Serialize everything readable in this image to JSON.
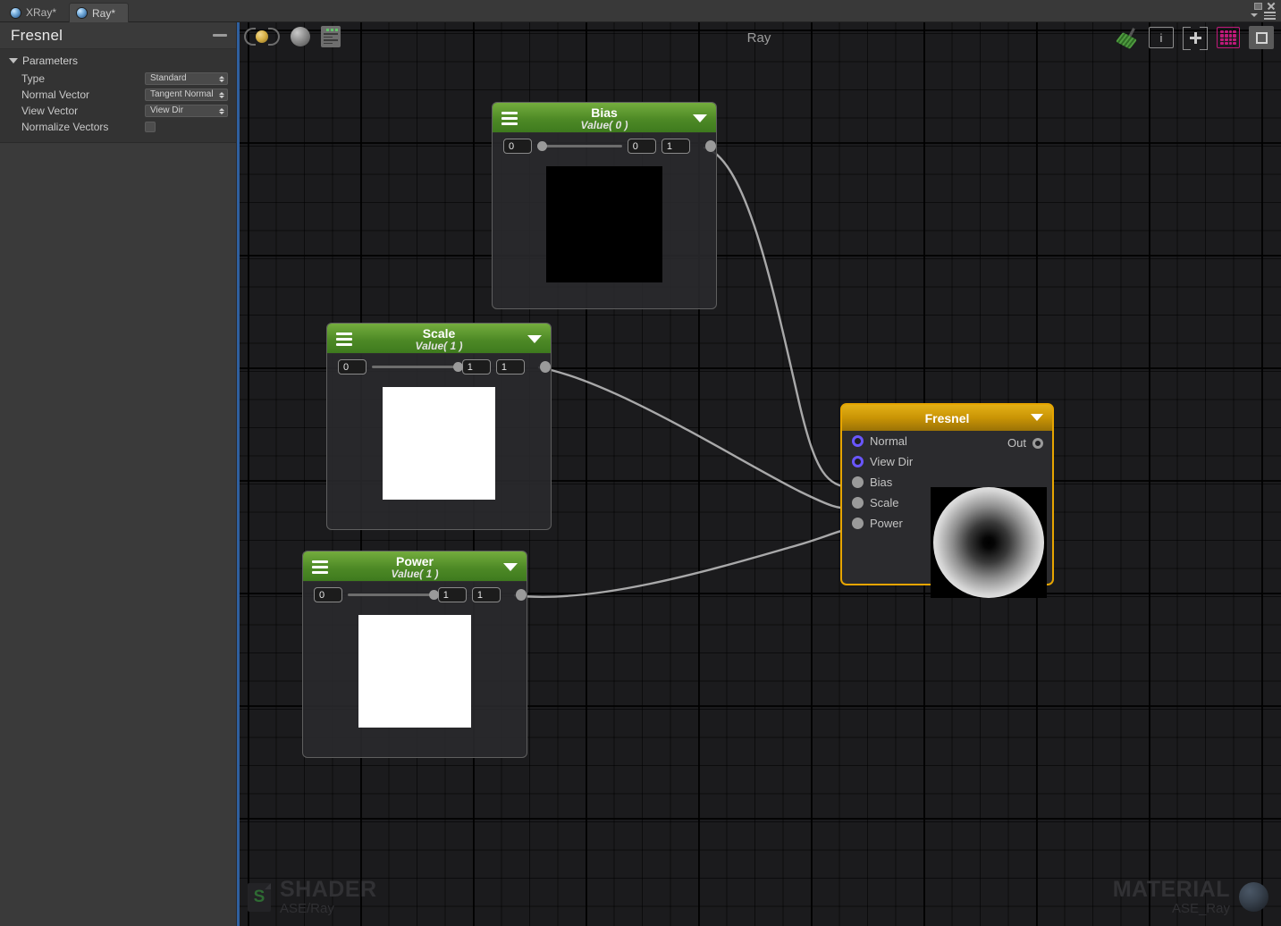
{
  "window": {
    "tabs": [
      {
        "label": "XRay*",
        "active": false
      },
      {
        "label": "Ray*",
        "active": true
      }
    ],
    "controls": {
      "restore": "restore-window",
      "close": "close-window",
      "menu": "window-menu"
    }
  },
  "inspector": {
    "title": "Fresnel",
    "minimize_label": "—",
    "foldout_label": "Parameters",
    "rows": [
      {
        "label": "Type",
        "type": "dropdown",
        "value": "Standard"
      },
      {
        "label": "Normal Vector",
        "type": "dropdown",
        "value": "Tangent Normal"
      },
      {
        "label": "View Vector",
        "type": "dropdown",
        "value": "View Dir"
      },
      {
        "label": "Normalize Vectors",
        "type": "checkbox",
        "value": ""
      }
    ]
  },
  "toolbar": {
    "title": "Ray",
    "left_icons": [
      "refresh-material-icon",
      "sphere-preview-icon",
      "shader-code-icon"
    ],
    "right_icons": [
      "cleanup-broom-icon",
      "info-icon",
      "add-node-icon",
      "grid-toggle-icon",
      "focus-icon"
    ],
    "info_glyph": "i",
    "accent_grid": "#c0197a",
    "accent_broom": "#4f9b3f"
  },
  "nodes": [
    {
      "id": "bias",
      "title": "Bias",
      "subtitle": "Value( 0 )",
      "min_field": "0",
      "max_field": "0",
      "value_field": "1",
      "slider_percent": 0,
      "preview_color": "#000000",
      "header_color": "#4e8a26"
    },
    {
      "id": "scale",
      "title": "Scale",
      "subtitle": "Value( 1 )",
      "min_field": "0",
      "max_field": "1",
      "value_field": "1",
      "slider_percent": 100,
      "preview_color": "#ffffff",
      "header_color": "#4e8a26"
    },
    {
      "id": "power",
      "title": "Power",
      "subtitle": "Value( 1 )",
      "min_field": "0",
      "max_field": "1",
      "value_field": "1",
      "slider_percent": 100,
      "preview_color": "#ffffff",
      "header_color": "#4e8a26"
    }
  ],
  "fresnel_node": {
    "title": "Fresnel",
    "border_color": "#e7a500",
    "inputs": [
      {
        "label": "Normal",
        "port": "ring",
        "connected": false
      },
      {
        "label": "View Dir",
        "port": "ring",
        "connected": false
      },
      {
        "label": "Bias",
        "port": "dot",
        "connected": true
      },
      {
        "label": "Scale",
        "port": "dot",
        "connected": true
      },
      {
        "label": "Power",
        "port": "dot",
        "connected": true
      }
    ],
    "output": {
      "label": "Out",
      "port": "ring"
    }
  },
  "connections": [
    {
      "from": "bias",
      "to": "Bias"
    },
    {
      "from": "scale",
      "to": "Scale"
    },
    {
      "from": "power",
      "to": "Power"
    }
  ],
  "watermarks": {
    "shader": {
      "big": "SHADER",
      "sub": "ASE/Ray",
      "icon_letter": "S"
    },
    "material": {
      "big": "MATERIAL",
      "sub": "ASE_Ray"
    }
  }
}
